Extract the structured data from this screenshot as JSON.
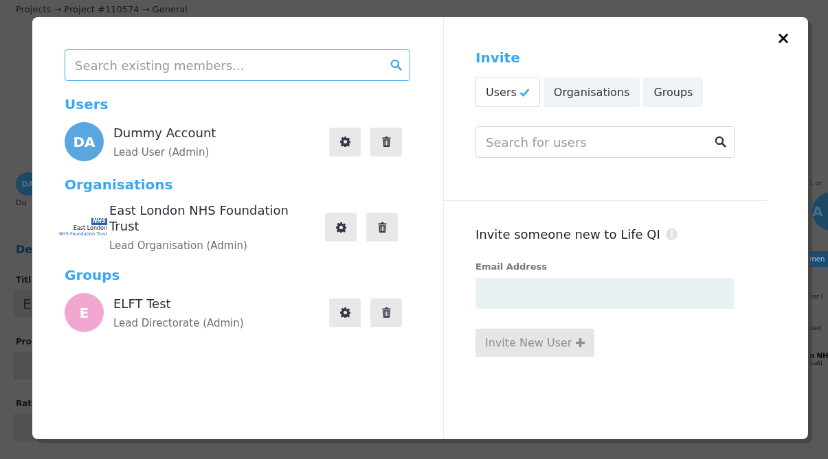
{
  "background": {
    "breadcrumb": "Projects → Project #110574 → General",
    "left_fragments": [
      {
        "kind": "avatar",
        "text": "DA"
      },
      {
        "kind": "text",
        "text": "Du"
      },
      {
        "kind": "heading",
        "text": "De"
      },
      {
        "kind": "label",
        "text": "Titl"
      },
      {
        "kind": "field",
        "text": "E"
      },
      {
        "kind": "label",
        "text": "Pro"
      },
      {
        "kind": "field"
      },
      {
        "kind": "label",
        "text": "Rat"
      },
      {
        "kind": "field"
      }
    ],
    "right_fragments": [
      {
        "kind": "text",
        "text": "1 or"
      },
      {
        "kind": "avatar",
        "text": "A"
      },
      {
        "kind": "button",
        "text": "men"
      },
      {
        "kind": "text",
        "text": "ser ("
      },
      {
        "kind": "text",
        "text": "ead"
      },
      {
        "kind": "strong",
        "text": "n NH"
      },
      {
        "kind": "text",
        "text": "isati"
      }
    ]
  },
  "modal": {
    "members_search": {
      "placeholder": "Search existing members..."
    },
    "sections": [
      {
        "heading": "Users",
        "members": [
          {
            "name": "Dummy Account",
            "role": "Lead User (Admin)",
            "avatar": {
              "kind": "initials",
              "text": "DA",
              "color": "#5aa7e0"
            }
          }
        ]
      },
      {
        "heading": "Organisations",
        "members": [
          {
            "name": "East London NHS Foundation Trust",
            "role": "Lead Organisation (Admin)",
            "avatar": {
              "kind": "logo",
              "badge": "NHS",
              "line1": "East London",
              "line2": "NHS Foundation Trust"
            }
          }
        ]
      },
      {
        "heading": "Groups",
        "members": [
          {
            "name": "ELFT Test",
            "role": "Lead Directorate (Admin)",
            "avatar": {
              "kind": "initials",
              "text": "E",
              "color": "#f2a7d0"
            }
          }
        ]
      }
    ],
    "invite": {
      "title": "Invite",
      "tabs": [
        {
          "label": "Users",
          "selected": true
        },
        {
          "label": "Organisations",
          "selected": false
        },
        {
          "label": "Groups",
          "selected": false
        }
      ],
      "search": {
        "placeholder": "Search for users"
      },
      "new_title": "Invite someone new to Life QI",
      "email_label": "Email Address",
      "submit": {
        "label": "Invite New User",
        "disabled": true
      }
    }
  }
}
